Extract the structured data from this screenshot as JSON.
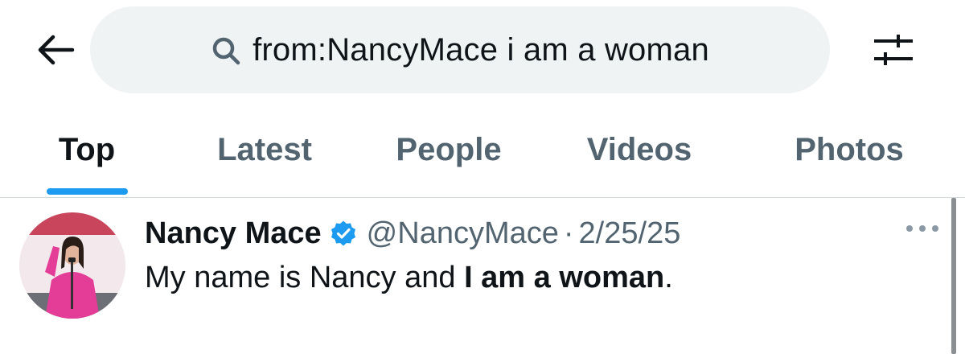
{
  "search": {
    "query": "from:NancyMace i am a woman"
  },
  "tabs": [
    {
      "label": "Top",
      "active": true
    },
    {
      "label": "Latest",
      "active": false
    },
    {
      "label": "People",
      "active": false
    },
    {
      "label": "Videos",
      "active": false
    },
    {
      "label": "Photos",
      "active": false
    }
  ],
  "tweet": {
    "display_name": "Nancy Mace",
    "verified": true,
    "handle": "@NancyMace",
    "separator": "·",
    "date": "2/25/25",
    "text_regular": "My name is Nancy and ",
    "text_bold": "I am a woman",
    "text_end": "."
  },
  "icons": {
    "back": "back-arrow-icon",
    "search": "search-icon",
    "filter": "filter-sliders-icon",
    "verified": "verified-badge-icon",
    "more": "more-dots-icon"
  },
  "colors": {
    "accent": "#1d9bf0",
    "text_primary": "#0f1419",
    "text_secondary": "#536471",
    "search_bg": "#eff3f4",
    "divider": "#cfd9de"
  }
}
